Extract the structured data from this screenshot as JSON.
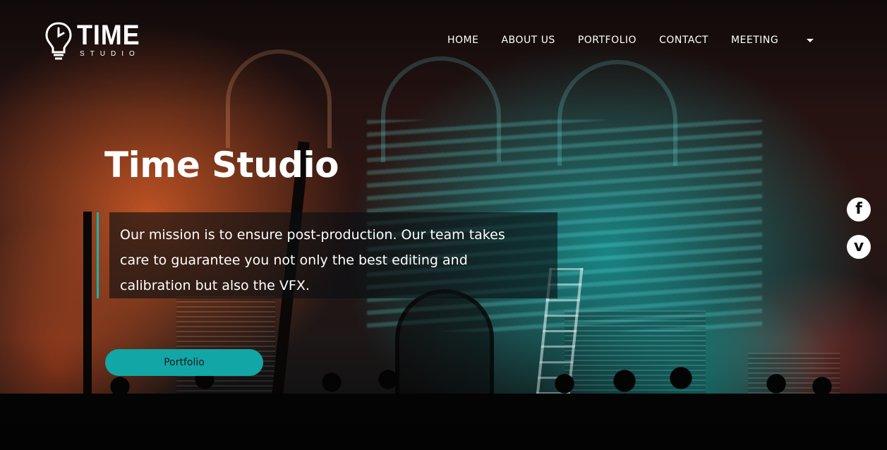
{
  "brand": {
    "name": "TIME",
    "sub": "STUDIO"
  },
  "nav": {
    "items": [
      "HOME",
      "ABOUT US",
      "PORTFOLIO",
      "CONTACT",
      "MEETING"
    ]
  },
  "hero": {
    "title": "Time Studio",
    "mission": "Our mission is to ensure post-production. Our team takes care to guarantee you not only the best editing and calibration but also the VFX.",
    "cta_label": "Portfolio"
  },
  "social": {
    "facebook_glyph": "f",
    "vimeo_glyph": "v"
  },
  "colors": {
    "accent": "#12a6a6",
    "text": "#ffffff"
  },
  "icons": [
    "lightbulb-clock-icon",
    "dropdown-caret-icon",
    "facebook-icon",
    "vimeo-icon"
  ]
}
